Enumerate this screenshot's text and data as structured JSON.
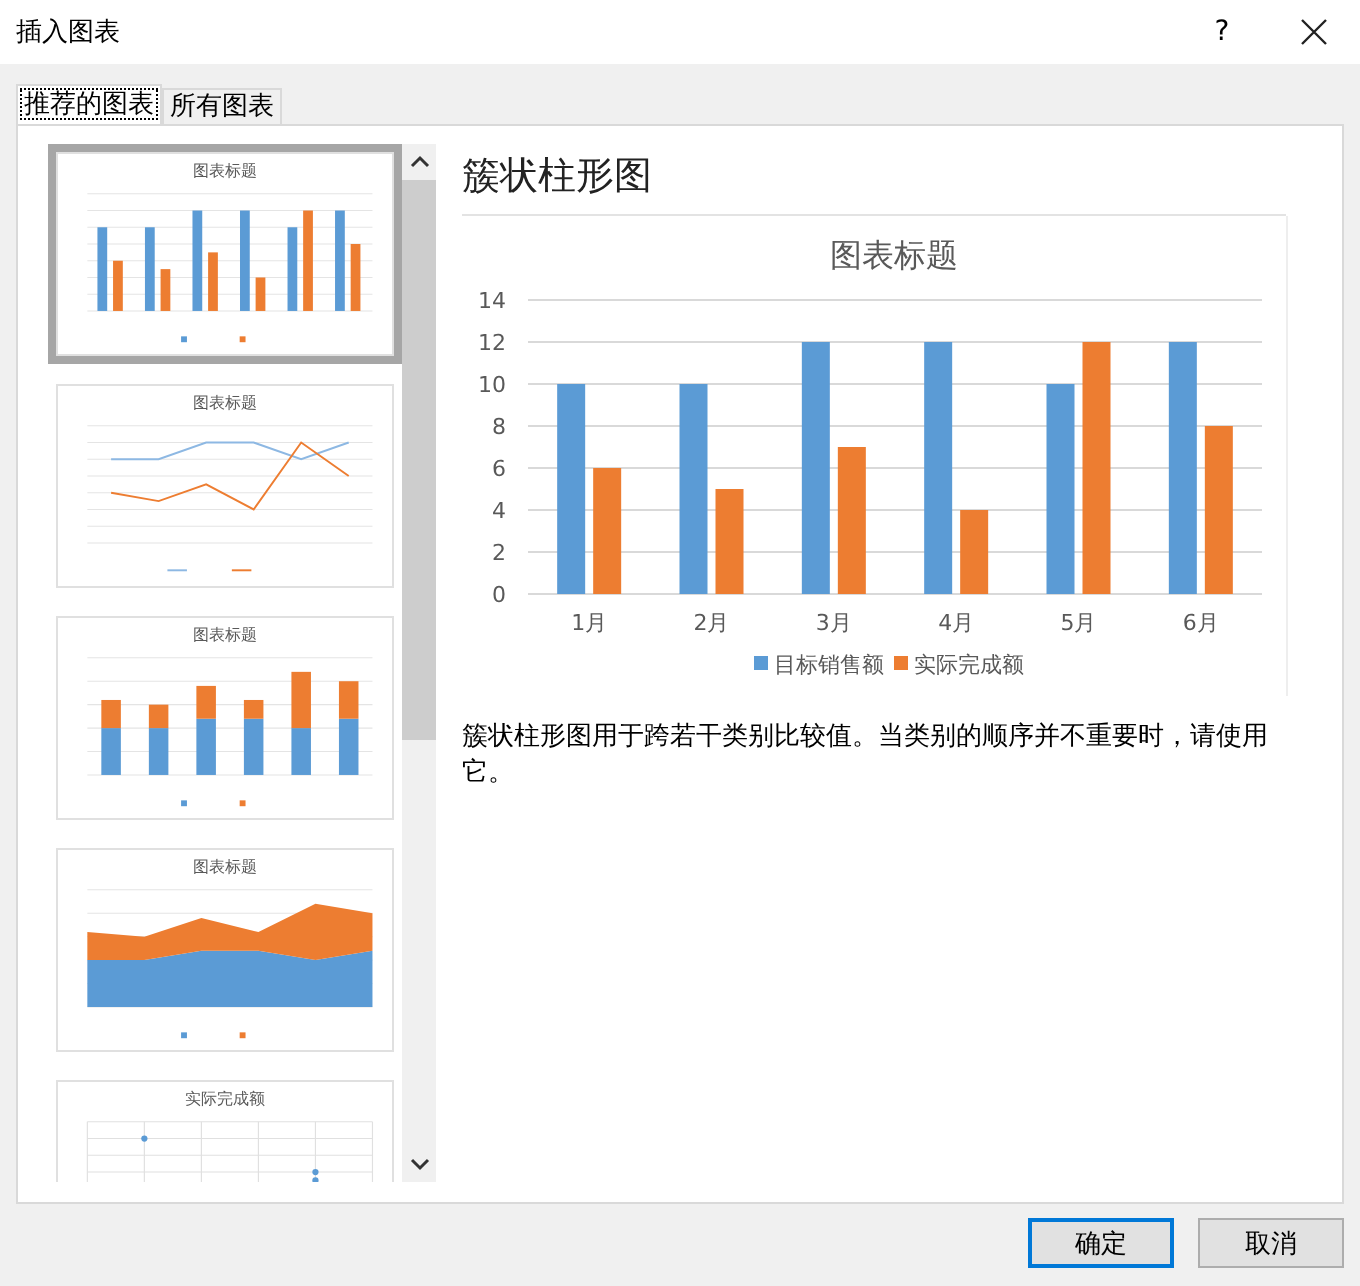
{
  "window": {
    "title": "插入图表",
    "help": "?"
  },
  "tabs": [
    {
      "label": "推荐的图表",
      "selected": true
    },
    {
      "label": "所有图表",
      "selected": false
    }
  ],
  "thumbnails": [
    {
      "kind": "clustered-column",
      "title": "图表标题",
      "selected": true
    },
    {
      "kind": "line",
      "title": "图表标题",
      "selected": false
    },
    {
      "kind": "stacked-column",
      "title": "图表标题",
      "selected": false
    },
    {
      "kind": "area",
      "title": "图表标题",
      "selected": false
    },
    {
      "kind": "scatter",
      "title": "实际完成额",
      "selected": false
    }
  ],
  "preview": {
    "name": "簇状柱形图",
    "chart_data": {
      "type": "bar",
      "title": "图表标题",
      "categories": [
        "1月",
        "2月",
        "3月",
        "4月",
        "5月",
        "6月"
      ],
      "series": [
        {
          "name": "目标销售额",
          "color": "#5b9bd5",
          "values": [
            10,
            10,
            12,
            12,
            10,
            12
          ]
        },
        {
          "name": "实际完成额",
          "color": "#ed7d31",
          "values": [
            6,
            5,
            7,
            4,
            12,
            8
          ]
        }
      ],
      "grid": true,
      "legend": true,
      "ylim": [
        0,
        14
      ],
      "yticks": [
        0,
        2,
        4,
        6,
        8,
        10,
        12,
        14
      ]
    },
    "description": "簇状柱形图用于跨若干类别比较值。当类别的顺序并不重要时，请使用它。"
  },
  "buttons": [
    {
      "label": "确定",
      "default": true
    },
    {
      "label": "取消",
      "default": false
    }
  ]
}
